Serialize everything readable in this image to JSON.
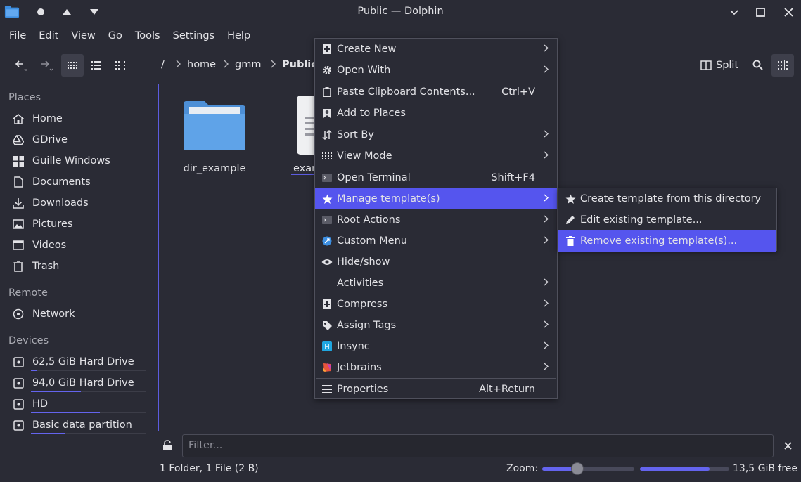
{
  "window": {
    "title": "Public — Dolphin"
  },
  "menubar": [
    "File",
    "Edit",
    "View",
    "Go",
    "Tools",
    "Settings",
    "Help"
  ],
  "breadcrumb": [
    "/",
    "home",
    "gmm",
    "Public"
  ],
  "toolbar": {
    "split_label": "Split"
  },
  "sidebar": {
    "places_heading": "Places",
    "places": [
      "Home",
      "GDrive",
      "Guille Windows",
      "Documents",
      "Downloads",
      "Pictures",
      "Videos",
      "Trash"
    ],
    "remote_heading": "Remote",
    "remote": [
      "Network"
    ],
    "devices_heading": "Devices",
    "devices": [
      {
        "label": "62,5 GiB Hard Drive",
        "used_fraction": 0.05
      },
      {
        "label": "94,0 GiB Hard Drive",
        "used_fraction": 0.43
      },
      {
        "label": "HD",
        "used_fraction": 0.6
      },
      {
        "label": "Basic data partition",
        "used_fraction": 0.3
      }
    ]
  },
  "files": [
    {
      "name": "dir_example",
      "type": "folder"
    },
    {
      "name": "example",
      "type": "file",
      "visible_label": "exam"
    }
  ],
  "filter": {
    "placeholder": "Filter..."
  },
  "status": {
    "summary": "1 Folder, 1 File (2 B)",
    "zoom_label": "Zoom:",
    "zoom_fraction": 0.38,
    "free_label": "13,5 GiB free",
    "used_fraction": 0.78
  },
  "context_menu": {
    "items": [
      {
        "label": "Create New",
        "icon": "plus-document-icon",
        "submenu": true
      },
      {
        "label": "Open With",
        "icon": "gear-icon",
        "submenu": true
      },
      {
        "label": "Paste Clipboard Contents...",
        "icon": "clipboard-icon",
        "shortcut": "Ctrl+V"
      },
      {
        "label": "Add to Places",
        "icon": "bookmark-add-icon"
      },
      {
        "label": "Sort By",
        "icon": "sort-icon",
        "submenu": true
      },
      {
        "label": "View Mode",
        "icon": "grid-icon",
        "submenu": true
      },
      {
        "label": "Open Terminal",
        "icon": "terminal-icon",
        "shortcut": "Shift+F4"
      },
      {
        "label": "Manage template(s)",
        "icon": "star-icon",
        "submenu": true,
        "highlighted": true
      },
      {
        "label": "Root Actions",
        "icon": "terminal-icon",
        "submenu": true
      },
      {
        "label": "Custom Menu",
        "icon": "blue-circle-icon",
        "submenu": true
      },
      {
        "label": "Hide/show",
        "icon": "eye-icon"
      },
      {
        "label": "Activities",
        "icon": "",
        "submenu": true
      },
      {
        "label": "Compress",
        "icon": "plus-document-icon",
        "submenu": true
      },
      {
        "label": "Assign Tags",
        "icon": "tag-icon",
        "submenu": true
      },
      {
        "label": "Insync",
        "icon": "insync-icon",
        "submenu": true
      },
      {
        "label": "Jetbrains",
        "icon": "jetbrains-icon",
        "submenu": true
      },
      {
        "label": "Properties",
        "icon": "properties-icon",
        "shortcut": "Alt+Return"
      }
    ],
    "submenu": [
      {
        "label": "Create template from this directory",
        "icon": "star-icon"
      },
      {
        "label": "Edit existing template...",
        "icon": "pencil-icon"
      },
      {
        "label": "Remove existing template(s)...",
        "icon": "trash-icon",
        "highlighted": true
      }
    ]
  },
  "colors": {
    "accent": "#5555ee",
    "background": "#2a2b35",
    "folder": "#4d8fd6"
  }
}
